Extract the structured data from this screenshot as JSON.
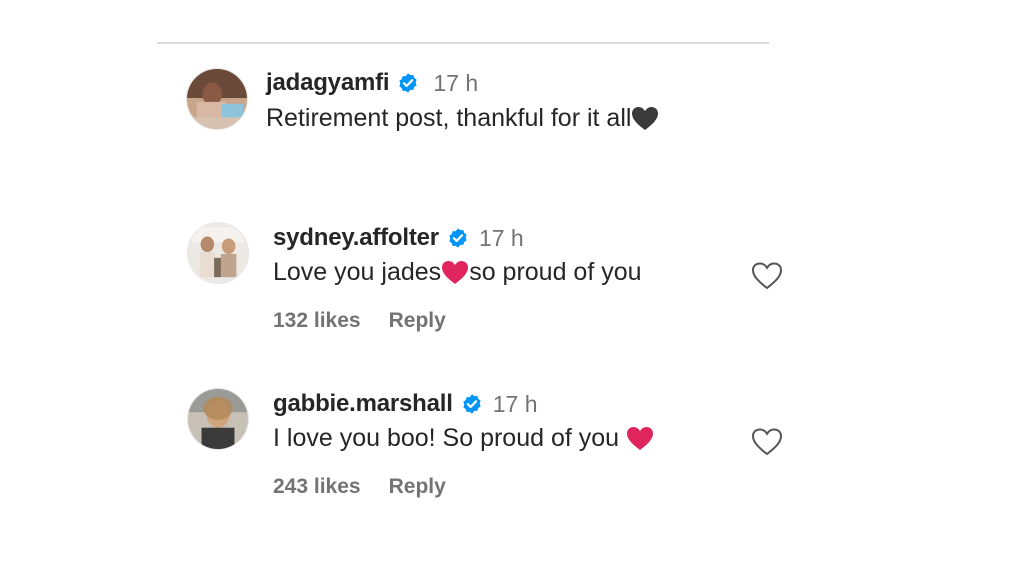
{
  "caption": {
    "username": "jadagyamfi",
    "time": "17 h",
    "text": "Retirement post, thankful for it all",
    "emoji": "black-heart"
  },
  "comments": [
    {
      "username": "sydney.affolter",
      "time": "17 h",
      "text_before": "Love you jades",
      "emoji": "red-heart",
      "text_after": "so proud of you",
      "likes": "132 likes",
      "reply": "Reply"
    },
    {
      "username": "gabbie.marshall",
      "time": "17 h",
      "text_before": "I love you boo! So proud of you ",
      "emoji": "red-heart",
      "text_after": "",
      "likes": "243 likes",
      "reply": "Reply"
    }
  ],
  "colors": {
    "verified": "#0095f6",
    "red_heart": "#e0245e",
    "black_heart": "#3a3a3a",
    "muted_text": "#737373",
    "divider": "#dbdbdb"
  }
}
